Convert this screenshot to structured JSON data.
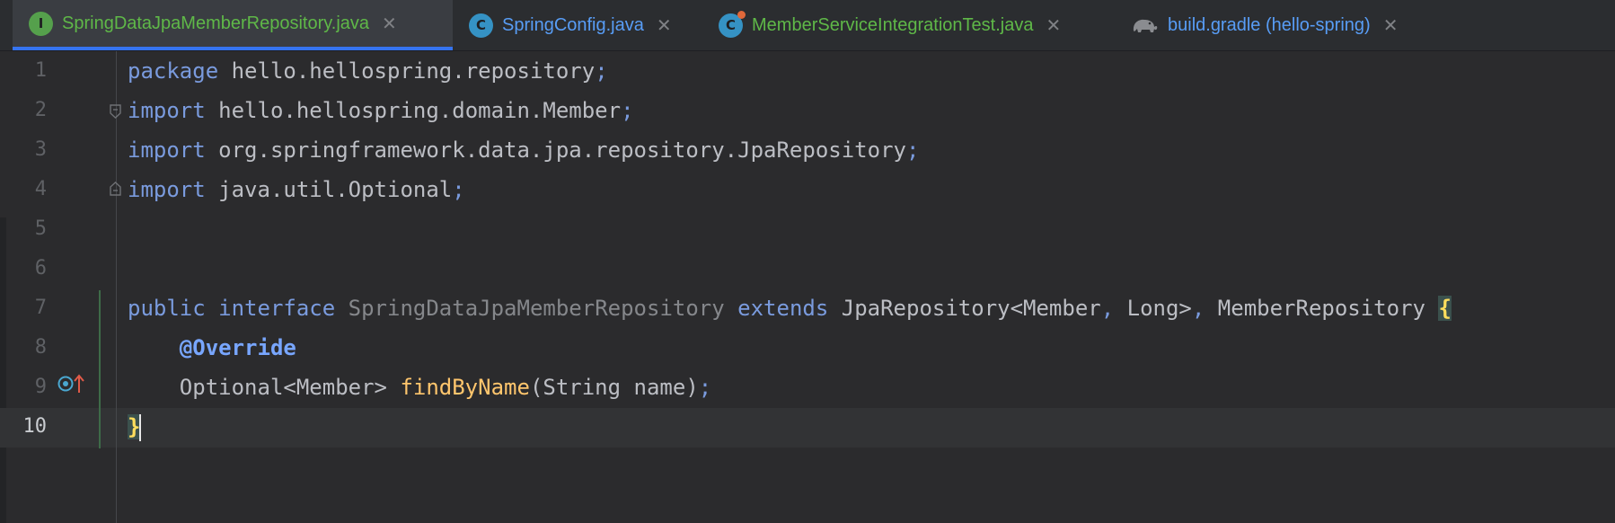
{
  "tabs": [
    {
      "label": "SpringDataJpaMemberRepository.java",
      "icon": "interface-icon",
      "icon_letter": "I",
      "active": true,
      "color": "#5fb848"
    },
    {
      "label": "SpringConfig.java",
      "icon": "class-icon",
      "icon_letter": "C",
      "active": false,
      "color": "#589df6"
    },
    {
      "label": "MemberServiceIntegrationTest.java",
      "icon": "test-class-icon",
      "icon_letter": "C",
      "active": false,
      "color": "#5fb848"
    },
    {
      "label": "build.gradle (hello-spring)",
      "icon": "gradle-elephant-icon",
      "active": false,
      "color": "#589df6"
    }
  ],
  "close_glyph": "✕",
  "editor": {
    "current_line": 10,
    "lines": [
      {
        "n": "1",
        "t": [
          [
            "kw",
            "package"
          ],
          [
            "ty",
            " hello.hellospring.repository"
          ],
          [
            "punc",
            ";"
          ]
        ]
      },
      {
        "n": "2",
        "t": [
          [
            "kw",
            "import"
          ],
          [
            "ty",
            " hello.hellospring.domain.Member"
          ],
          [
            "punc",
            ";"
          ]
        ]
      },
      {
        "n": "3",
        "t": [
          [
            "kw",
            "import"
          ],
          [
            "ty",
            " org.springframework.data.jpa.repository.JpaRepository"
          ],
          [
            "punc",
            ";"
          ]
        ]
      },
      {
        "n": "4",
        "t": [
          [
            "kw",
            "import"
          ],
          [
            "ty",
            " java.util.Optional"
          ],
          [
            "punc",
            ";"
          ]
        ]
      },
      {
        "n": "5",
        "t": []
      },
      {
        "n": "6",
        "t": []
      },
      {
        "n": "7",
        "t": [
          [
            "kw",
            "public"
          ],
          [
            "ty",
            " "
          ],
          [
            "kw",
            "interface"
          ],
          [
            "ty",
            " "
          ],
          [
            "iface-name",
            "SpringDataJpaMemberRepository"
          ],
          [
            "ty",
            " "
          ],
          [
            "kw",
            "extends"
          ],
          [
            "ty",
            " JpaRepository<Member"
          ],
          [
            "punc",
            ","
          ],
          [
            "ty",
            " Long>"
          ],
          [
            "punc",
            ","
          ],
          [
            "ty",
            " MemberRepository "
          ],
          [
            "brace",
            "{"
          ]
        ]
      },
      {
        "n": "8",
        "t": [
          [
            "ty",
            "    "
          ],
          [
            "ann",
            "@Override"
          ]
        ]
      },
      {
        "n": "9",
        "t": [
          [
            "ty",
            "    Optional<Member> "
          ],
          [
            "fn",
            "findByName"
          ],
          [
            "ty",
            "(String name)"
          ],
          [
            "punc",
            ";"
          ]
        ]
      },
      {
        "n": "10",
        "t": [
          [
            "brace",
            "}"
          ]
        ]
      }
    ]
  }
}
